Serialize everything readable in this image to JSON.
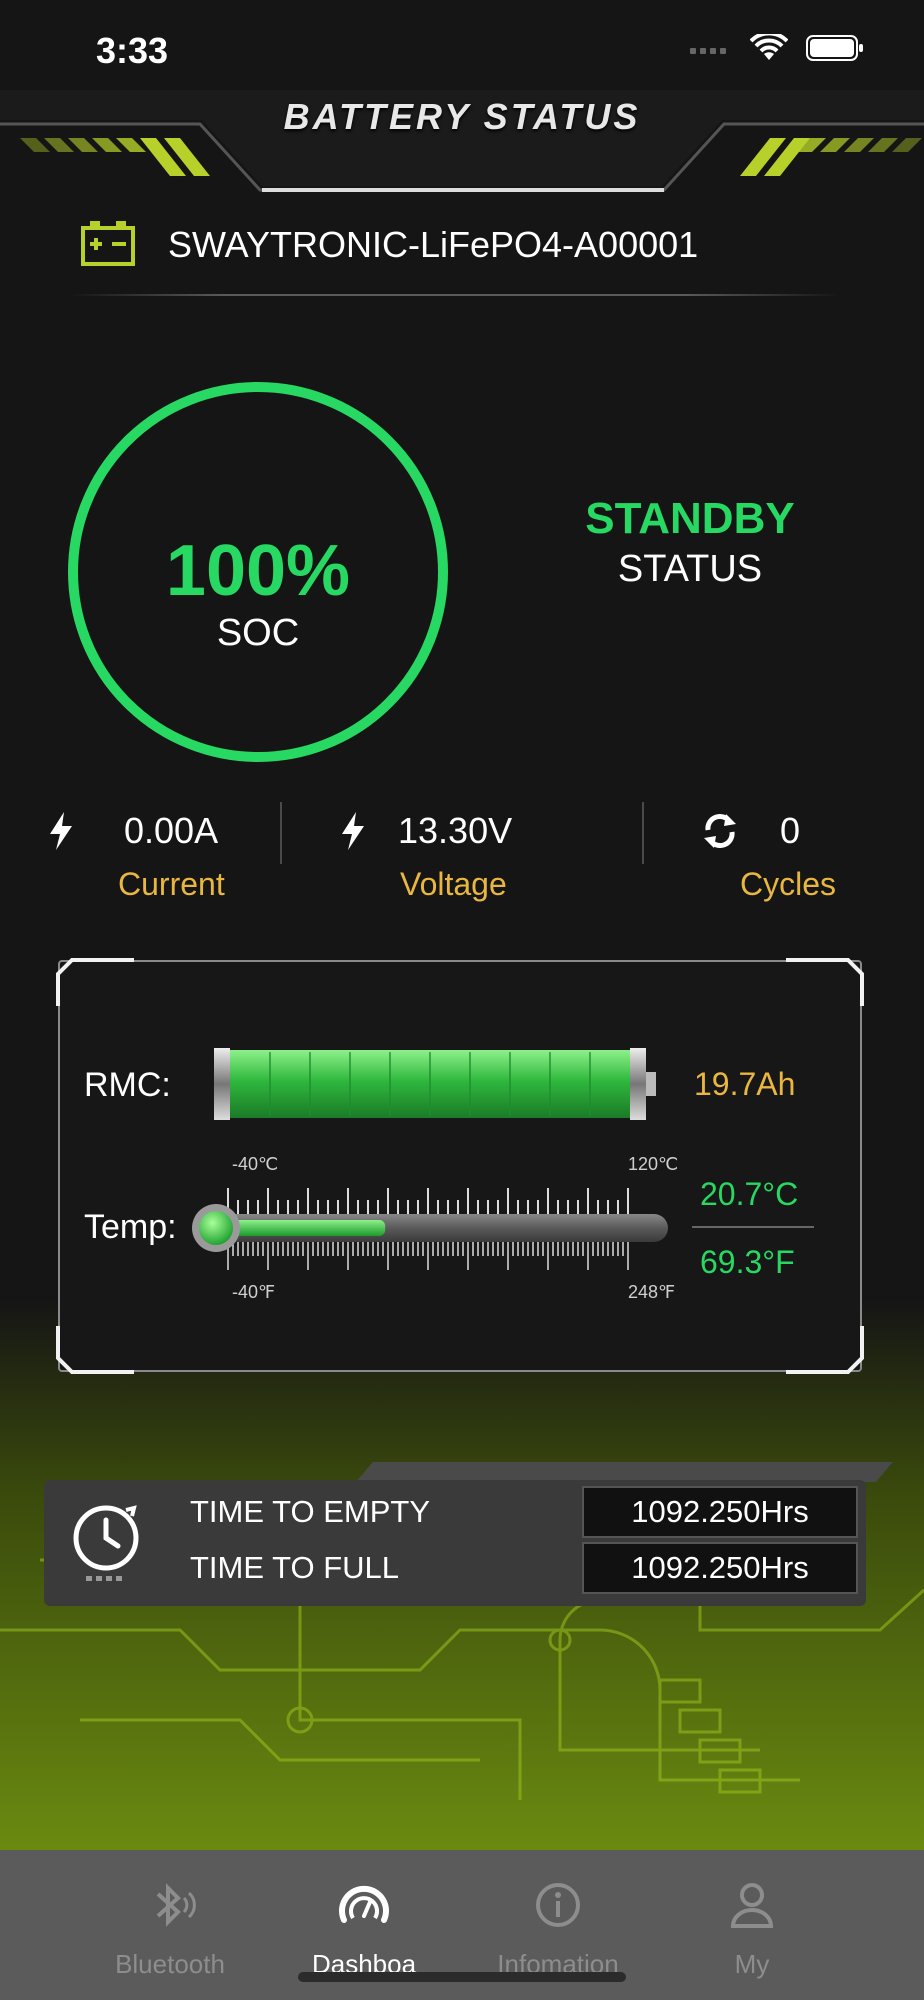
{
  "status_bar": {
    "time": "3:33"
  },
  "header": {
    "title": "BATTERY STATUS"
  },
  "device": {
    "name": "SWAYTRONIC-LiFePO4-A00001",
    "icon": "battery-icon"
  },
  "soc": {
    "value": "100%",
    "label": "SOC",
    "fraction": 1.0
  },
  "state": {
    "value": "STANDBY",
    "label": "STATUS"
  },
  "metrics": [
    {
      "value": "0.00A",
      "label": "Current",
      "icon": "lightning-icon"
    },
    {
      "value": "13.30V",
      "label": "Voltage",
      "icon": "lightning-icon"
    },
    {
      "value": "0",
      "label": "Cycles",
      "icon": "refresh-icon"
    }
  ],
  "panel": {
    "rmc_label": "RMC:",
    "rmc_value": "19.7Ah",
    "rmc_fraction": 1.0,
    "temp_label": "Temp:",
    "temp_c": "20.7°C",
    "temp_f": "69.3°F",
    "scale_c_min": "-40℃",
    "scale_c_max": "120℃",
    "scale_f_min": "-40℉",
    "scale_f_max": "248℉",
    "temp_fraction": 0.38
  },
  "times": {
    "empty_label": "TIME TO EMPTY",
    "empty_value": "1092.250Hrs",
    "full_label": "TIME TO FULL",
    "full_value": "1092.250Hrs"
  },
  "tabs": [
    {
      "label": "Bluetooth",
      "icon": "bluetooth-icon",
      "active": false
    },
    {
      "label": "Dashboa",
      "icon": "dashboard-icon",
      "active": true
    },
    {
      "label": "Infomation",
      "icon": "info-icon",
      "active": false
    },
    {
      "label": "My",
      "icon": "user-icon",
      "active": false
    }
  ],
  "colors": {
    "accent_green": "#27d862",
    "label_yellow": "#e9b640",
    "header_stripe": "#b7d12a"
  }
}
